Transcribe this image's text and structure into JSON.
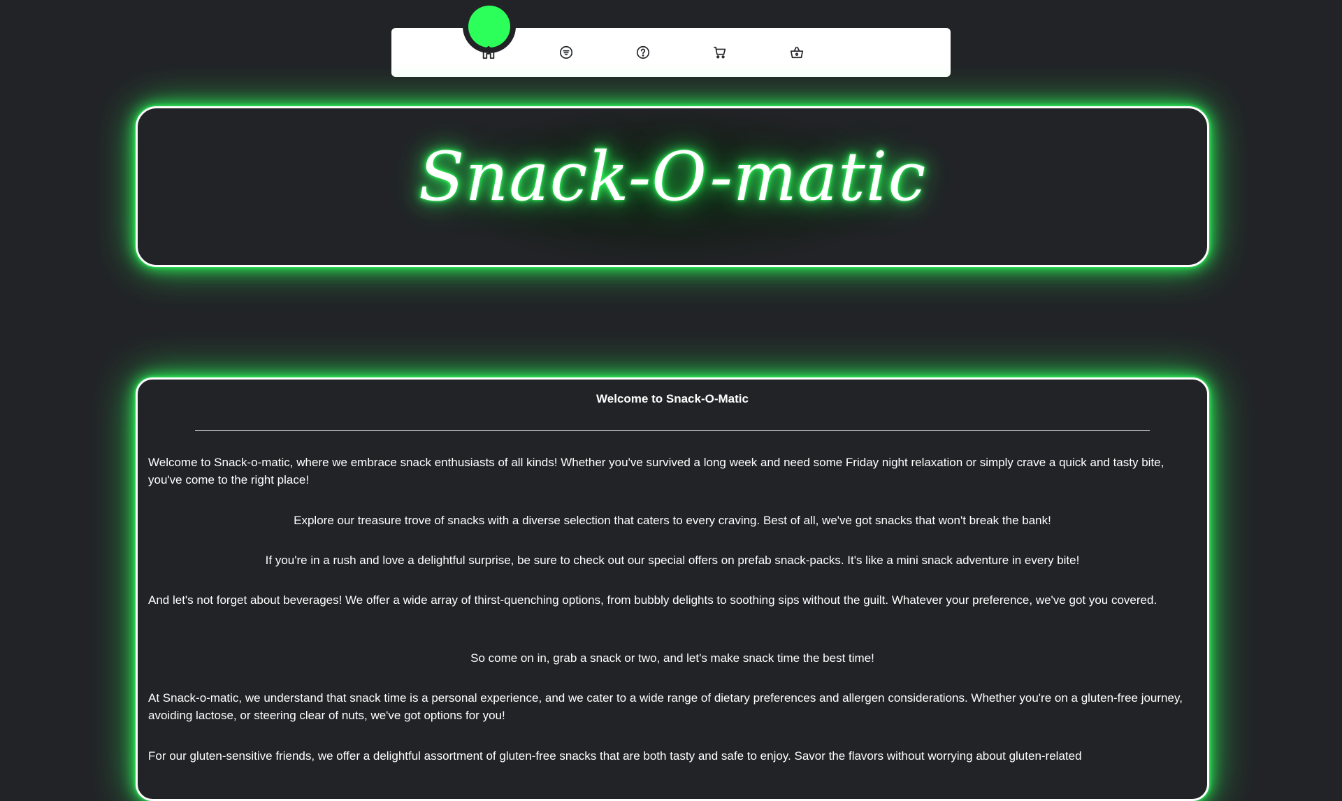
{
  "nav": {
    "items": [
      {
        "id": "home",
        "icon": "home-icon",
        "active": true
      },
      {
        "id": "menu",
        "icon": "menu-list-icon",
        "active": false
      },
      {
        "id": "help",
        "icon": "question-icon",
        "active": false
      },
      {
        "id": "cart",
        "icon": "cart-icon",
        "active": false
      },
      {
        "id": "basket",
        "icon": "basket-icon",
        "active": false
      }
    ]
  },
  "header": {
    "title": "Snack-O-matic"
  },
  "content": {
    "title": "Welcome to Snack-O-Matic",
    "paragraphs": [
      "Welcome to Snack-o-matic, where we embrace snack enthusiasts of all kinds! Whether you've survived a long week and need some Friday night relaxation or simply crave a quick and tasty bite, you've come to the right place!",
      "Explore our treasure trove of snacks with a diverse selection that caters to every craving. Best of all, we've got snacks that won't break the bank!",
      "If you're in a rush and love a delightful surprise, be sure to check out our special offers on prefab snack-packs. It's like a mini snack adventure in every bite!",
      "And let's not forget about beverages! We offer a wide array of thirst-quenching options, from bubbly delights to soothing sips without the guilt. Whatever your preference, we've got you covered.",
      "So come on in, grab a snack or two, and let's make snack time the best time!",
      "At Snack-o-matic, we understand that snack time is a personal experience, and we cater to a wide range of dietary preferences and allergen considerations. Whether you're on a gluten-free journey, avoiding lactose, or steering clear of nuts, we've got options for you!",
      "For our gluten-sensitive friends, we offer a delightful assortment of gluten-free snacks that are both tasty and safe to enjoy. Savor the flavors without worrying about gluten-related"
    ]
  },
  "colors": {
    "background": "#222327",
    "accent": "#2cff5a",
    "panel_border": "#ffffff",
    "nav_bg": "#ffffff"
  }
}
